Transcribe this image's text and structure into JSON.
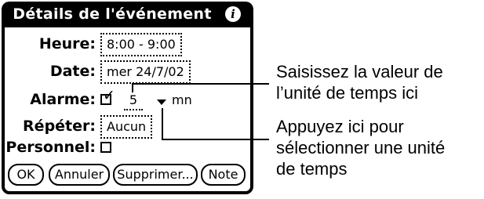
{
  "dialog": {
    "title": "Détails de l'événement",
    "info_icon": "info-icon"
  },
  "fields": {
    "time_label": "Heure:",
    "time_value": "8:00 - 9:00",
    "date_label": "Date:",
    "date_value": "mer 24/7/02",
    "alarm_label": "Alarme:",
    "alarm_checked": true,
    "alarm_value": "5",
    "alarm_unit": "mn",
    "repeat_label": "Répéter:",
    "repeat_value": "Aucun",
    "private_label": "Personnel:",
    "private_checked": false
  },
  "buttons": {
    "ok": "OK",
    "cancel": "Annuler",
    "delete": "Supprimer...",
    "note": "Note"
  },
  "callouts": {
    "value_line1": "Saisissez la valeur de",
    "value_line2": "l’unité de temps ici",
    "unit_line1": "Appuyez ici pour",
    "unit_line2": "sélectionner une unité",
    "unit_line3": "de temps"
  }
}
